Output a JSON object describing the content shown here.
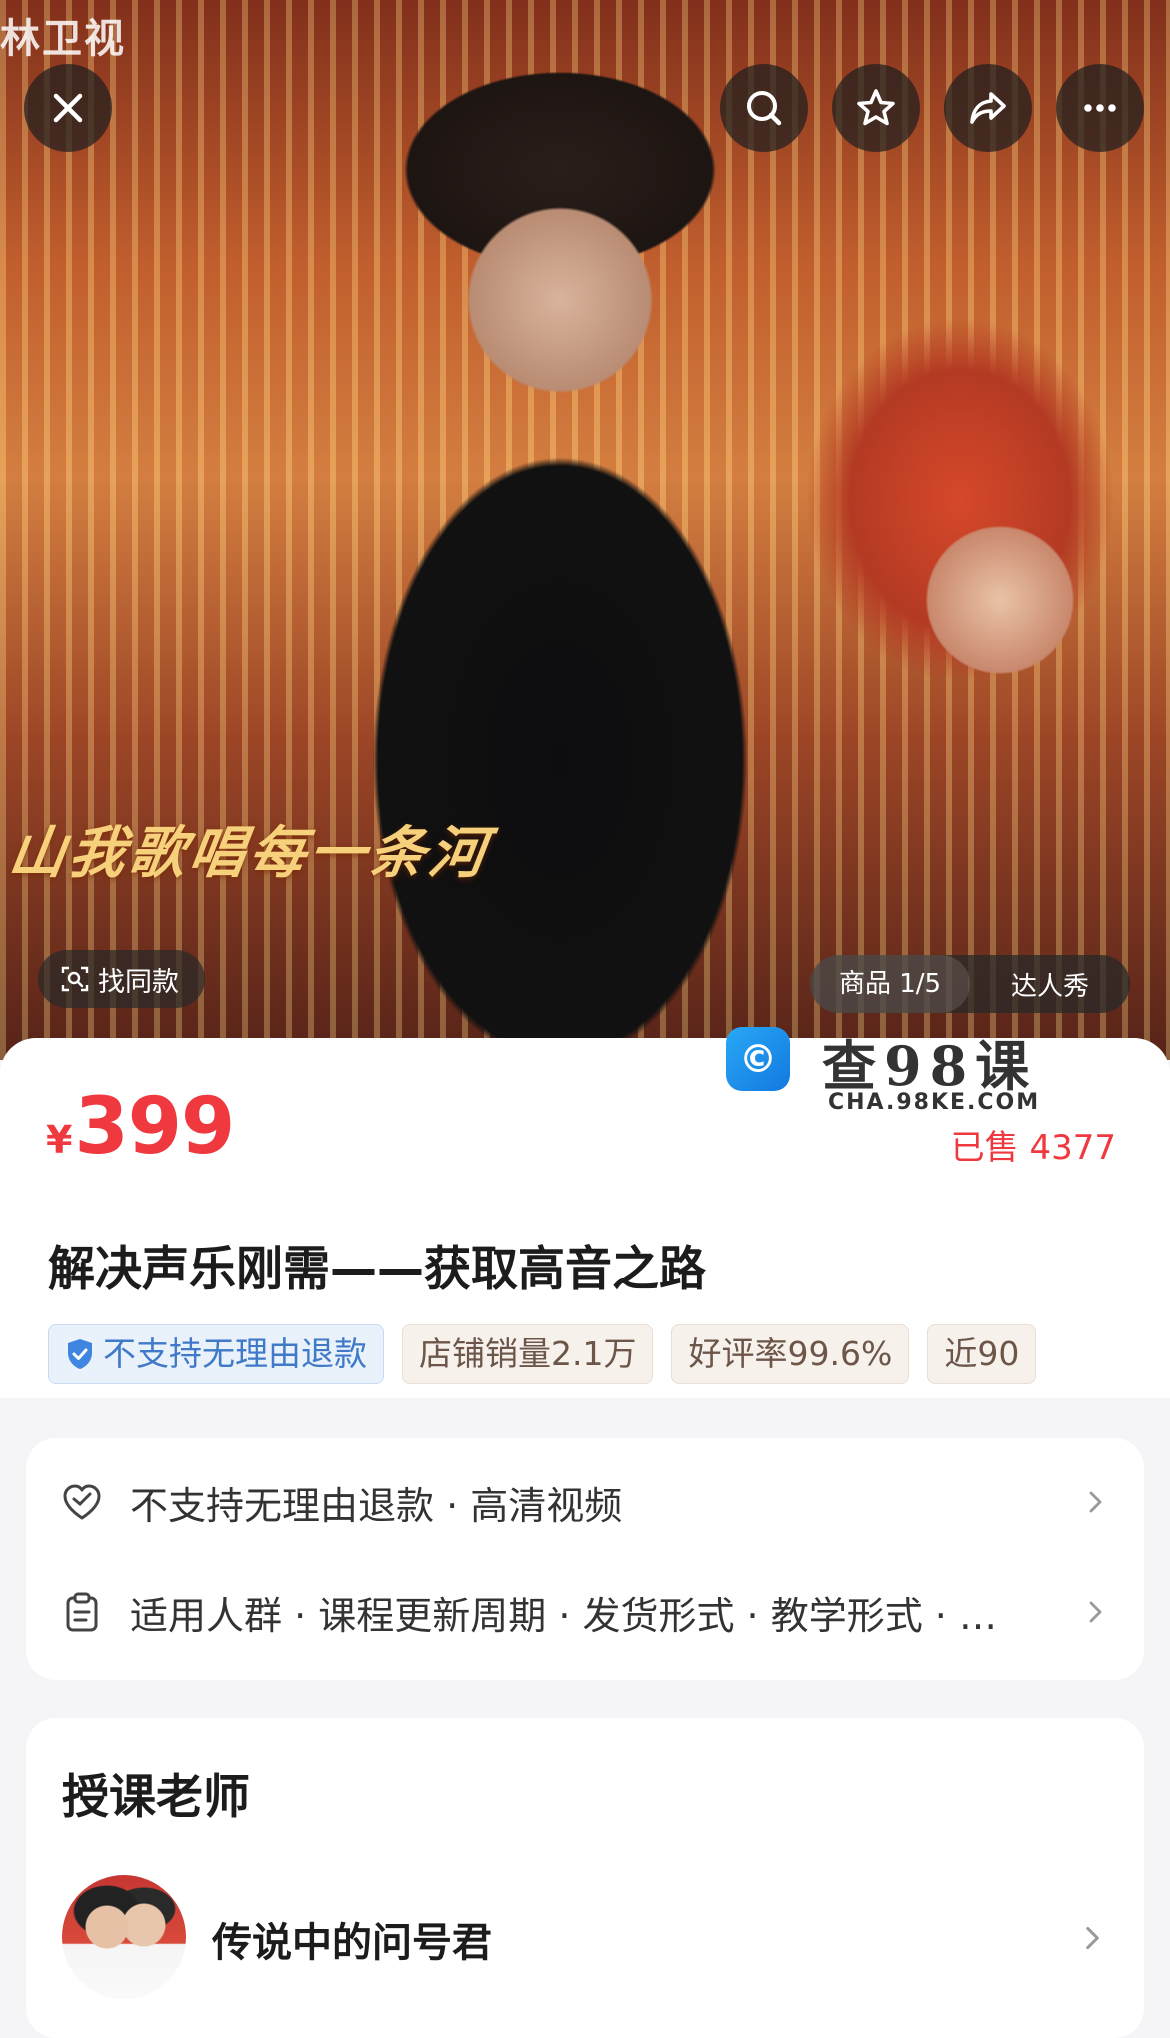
{
  "hero": {
    "channel_logo": "林卫视",
    "caption": "山我歌唱每一条河",
    "find_similar_label": "找同款",
    "tabs": [
      {
        "label": "商品 1/5",
        "active": true
      },
      {
        "label": "达人秀",
        "active": false
      }
    ],
    "icons": [
      "close-icon",
      "search-icon",
      "star-icon",
      "share-icon",
      "more-icon"
    ]
  },
  "product": {
    "currency": "¥",
    "price": "399",
    "sold": "已售 4377",
    "title": "解决声乐刚需——获取高音之路",
    "tags": [
      {
        "label": "不支持无理由退款",
        "style": "blue",
        "icon": "shield-check-icon"
      },
      {
        "label": "店铺销量2.1万",
        "style": "plain"
      },
      {
        "label": "好评率99.6%",
        "style": "plain"
      },
      {
        "label": "近90",
        "style": "plain"
      }
    ]
  },
  "watermark": {
    "text": "查98课",
    "sub": "CHA.98KE.COM"
  },
  "info": {
    "rows": [
      {
        "text": "不支持无理由退款 · 高清视频",
        "icon": "heart-badge-icon"
      },
      {
        "text": "适用人群 · 课程更新周期 · 发货形式 · 教学形式 · …",
        "icon": "clipboard-icon"
      }
    ]
  },
  "teacher": {
    "heading": "授课老师",
    "name": "传说中的问号君"
  },
  "colors": {
    "price_red": "#f0383f",
    "tag_blue": "#3f79c8"
  }
}
